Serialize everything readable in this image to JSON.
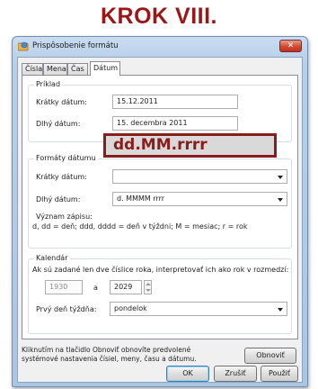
{
  "page": {
    "heading": "KROK VIII."
  },
  "window": {
    "title": "Prispôsobenie formátu",
    "close_glyph": "✕"
  },
  "tabs": [
    {
      "label": "Čísla"
    },
    {
      "label": "Mena"
    },
    {
      "label": "Čas"
    },
    {
      "label": "Dátum",
      "active": true
    }
  ],
  "example": {
    "legend": "Príklad",
    "short_label": "Krátky dátum:",
    "short_value": "15.12.2011",
    "long_label": "Dlhý dátum:",
    "long_value": "15. decembra 2011"
  },
  "formats": {
    "legend": "Formáty dátumu",
    "short_label": "Krátky dátum:",
    "short_value": "dd.MM.rrrr",
    "long_label": "Dlhý dátum:",
    "long_value": "d. MMMM rrrr",
    "meaning_label": "Význam zápisu:",
    "meaning_text": "d, dd = deň;  ddd, dddd = deň v týždni; M = mesiac; r = rok"
  },
  "calendar": {
    "legend": "Kalendár",
    "description": "Ak sú zadané len dve číslice roka, interpretovať ich ako rok v rozmedzí:",
    "year_from": "1930",
    "year_sep": "a",
    "year_to": "2029",
    "first_day_label": "Prvý deň týždňa:",
    "first_day_value": "pondelok"
  },
  "restore": {
    "note_line1": "Kliknutím na tlačidlo Obnoviť obnovíte predvolené",
    "note_line2": "systémové nastavenia čísiel, meny, času a dátumu.",
    "button": "Obnoviť"
  },
  "footer": {
    "ok": "OK",
    "cancel": "Zrušiť",
    "apply": "Použiť"
  },
  "colors": {
    "heading": "#9b1616",
    "highlight_border": "#8a1c1c"
  }
}
